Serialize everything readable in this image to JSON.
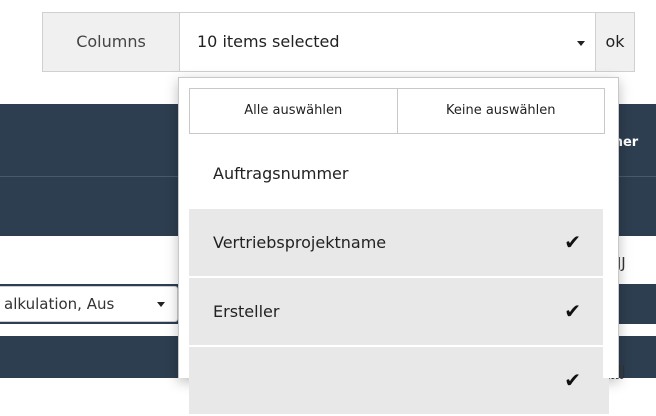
{
  "toolbar": {
    "columns_label": "Columns",
    "selection_summary": "10 items selected",
    "ok_label": "ok"
  },
  "dropdown": {
    "select_all": "Alle auswählen",
    "select_none": "Keine auswählen",
    "items": [
      {
        "label": "Auftragsnummer",
        "selected": false
      },
      {
        "label": "Vertriebsprojektname",
        "selected": true
      },
      {
        "label": "Ersteller",
        "selected": true
      },
      {
        "label": "",
        "selected": true
      }
    ],
    "check_glyph": "✔"
  },
  "background_table": {
    "header_partial": "cher",
    "cell_partial_1": "JJJJ",
    "cell_partial_2": "JJJJ",
    "filter_select_value": "alkulation, Aus"
  }
}
